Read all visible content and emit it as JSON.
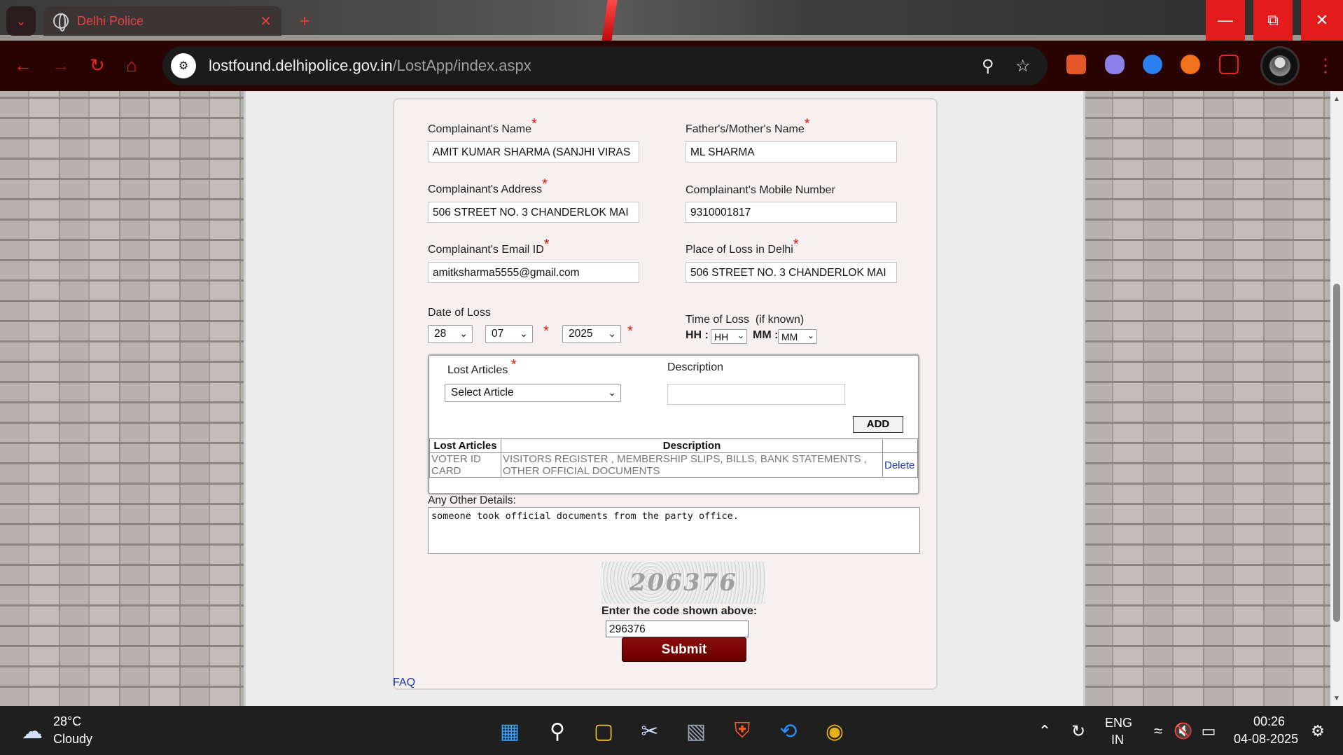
{
  "browser": {
    "tab_title": "Delhi Police",
    "url_host": "lostfound.delhipolice.gov.in",
    "url_path": "/LostApp/index.aspx"
  },
  "form": {
    "complainant_name_label": "Complainant's Name",
    "complainant_name_value": "AMIT KUMAR SHARMA (SANJHI VIRAS",
    "parent_name_label": "Father's/Mother's Name",
    "parent_name_value": "ML SHARMA",
    "address_label": "Complainant's Address",
    "address_value": "506 STREET NO. 3 CHANDERLOK MAI",
    "mobile_label": "Complainant's Mobile Number",
    "mobile_value": "9310001817",
    "email_label": "Complainant's Email ID",
    "email_value": "amitksharma5555@gmail.com",
    "place_label": "Place of Loss in Delhi",
    "place_value": "506 STREET NO. 3 CHANDERLOK MAI",
    "date_label": "Date of Loss",
    "date_day": "28",
    "date_month": "07",
    "date_year": "2025",
    "time_label": "Time of Loss  (if known)",
    "hh_label": "HH :",
    "hh_value": "HH",
    "mm_label": "MM :",
    "mm_value": "MM",
    "required_mark": "*"
  },
  "articles": {
    "lost_articles_label": "Lost Articles",
    "description_label": "Description",
    "select_value": "Select Article",
    "add_button": "ADD",
    "table_headers": [
      "Lost Articles",
      "Description",
      ""
    ],
    "rows": [
      {
        "article": "VOTER ID CARD",
        "description": "VISITORS REGISTER , MEMBERSHIP SLIPS, BILLS, BANK STATEMENTS , OTHER OFFICIAL DOCUMENTS",
        "action": "Delete"
      }
    ]
  },
  "other_details": {
    "label": "Any Other Details:",
    "value": "someone took official documents from the party office."
  },
  "captcha": {
    "image_text": "206376",
    "prompt": "Enter the code shown above:",
    "input_value": "296376",
    "submit": "Submit"
  },
  "faq_link": "FAQ",
  "taskbar": {
    "weather_temp": "28°C",
    "weather_desc": "Cloudy",
    "lang_line1": "ENG",
    "lang_line2": "IN",
    "time": "00:26",
    "date": "04-08-2025"
  },
  "colors": {
    "accent_red": "#e21b1b",
    "submit_maroon": "#7a0000",
    "link_blue": "#1a3aa8"
  }
}
